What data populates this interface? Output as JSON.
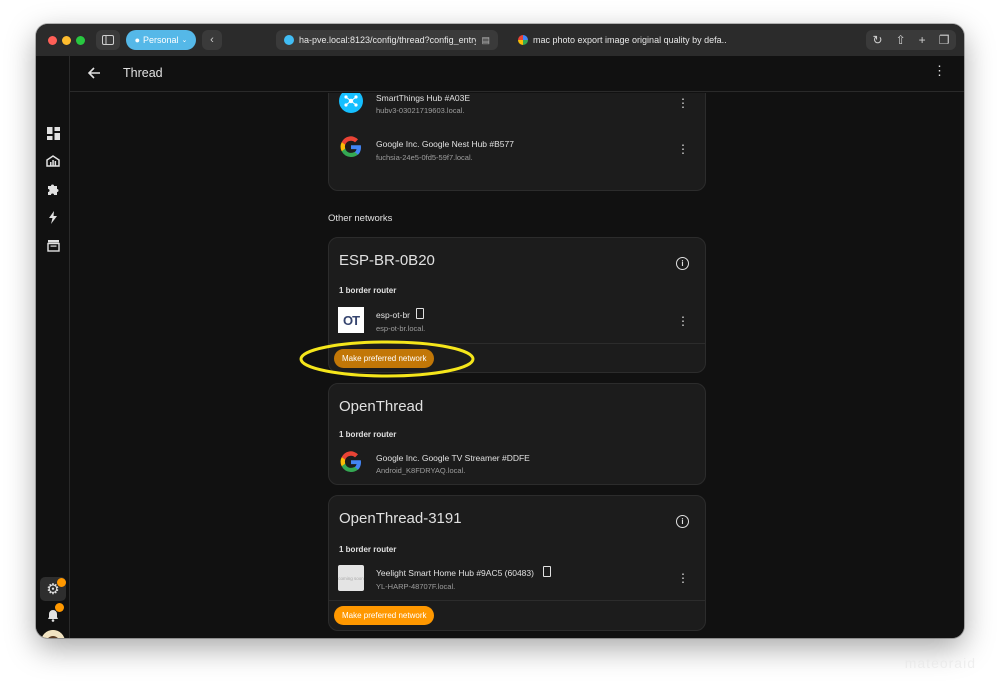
{
  "browser": {
    "profile_label": "Personal",
    "address_text": "ha-pve.local:8123/config/thread?config_entry=",
    "tab2_title": "mac photo export image original quality by defa...",
    "colors": {
      "close": "#ff5f57",
      "minimize": "#febc2e",
      "zoom": "#28c840",
      "profile": "#55b8e8"
    }
  },
  "app": {
    "title": "Thread",
    "accent": "#ff9800",
    "sidebar": {
      "items": [
        {
          "icon": "dashboard-icon"
        },
        {
          "icon": "energy-icon"
        },
        {
          "icon": "addons-puzzle-icon"
        },
        {
          "icon": "lightning-icon"
        },
        {
          "icon": "hacs-store-icon"
        }
      ],
      "settings_badge": "1",
      "notifications_badge": "1"
    }
  },
  "preferred_card": {
    "devices": [
      {
        "name": "SmartThings Hub #A03E",
        "host": "hubv3-03021719603.local.",
        "icon": "smartthings-icon"
      },
      {
        "name": "Google Inc. Google Nest Hub #B577",
        "host": "fuchsia-24e5-0fd5-59f7.local.",
        "icon": "google-icon"
      }
    ]
  },
  "other_networks_label": "Other networks",
  "networks": [
    {
      "name": "ESP-BR-0B20",
      "routers_label": "1 border router",
      "device": {
        "name": "esp-ot-br",
        "host": "esp-ot-br.local.",
        "icon": "openthread-logo-icon"
      },
      "button": "Make preferred network"
    },
    {
      "name": "OpenThread",
      "routers_label": "1 border router",
      "device": {
        "name": "Google Inc. Google TV Streamer #DDFE",
        "host": "Android_K8FDRYAQ.local.",
        "icon": "google-icon"
      }
    },
    {
      "name": "OpenThread-3191",
      "routers_label": "1 border router",
      "device": {
        "name": "Yeelight Smart Home Hub #9AC5 (60483)",
        "host": "YL-HARP-48707F.local.",
        "icon": "image-placeholder-icon",
        "placeholder_text": "coming soon"
      },
      "button": "Make preferred network"
    }
  ],
  "annotation": {
    "color": "#f5e61b"
  },
  "watermark": "mateoraid"
}
